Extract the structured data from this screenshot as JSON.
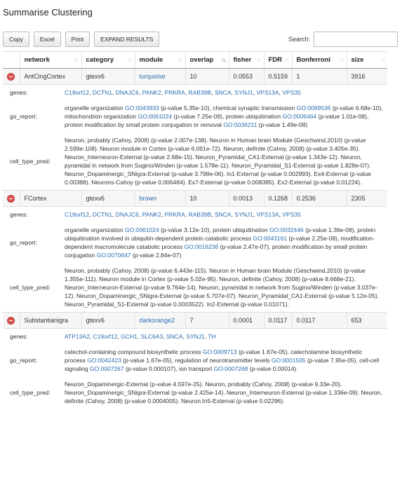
{
  "page": {
    "title": "Summarise Clustering"
  },
  "toolbar": {
    "copy": "Copy",
    "excel": "Excel",
    "print": "Print",
    "expand": "EXPAND RESULTS",
    "search_label": "Search:",
    "search_value": ""
  },
  "columns": [
    "network",
    "category",
    "module",
    "overlap",
    "fisher",
    "FDR",
    "Bonferroni",
    "size"
  ],
  "detail_labels": {
    "genes": "genes:",
    "go_report": "go_report:",
    "cell_type_pred": "cell_type_pred:"
  },
  "rows": [
    {
      "network": "AntCingCortex",
      "category": "gtexv6",
      "module": "turquoise",
      "overlap": "10",
      "fisher": "0.0553",
      "FDR": "0.5159",
      "Bonferroni": "1",
      "size": "3916",
      "genes": [
        "C19orf12",
        "DCTN1",
        "DNAJC6",
        "PANK2",
        "PRKRA",
        "RAB39B",
        "SNCA",
        "SYNJ1",
        "VPS13A",
        "VPS35"
      ],
      "go_report": [
        {
          "text": "organelle organization ",
          "go": "GO:0043933",
          "p": " (p-value 5.35e-10), "
        },
        {
          "text": "chemical synaptic transmission ",
          "go": "GO:0099536",
          "p": " (p-value 6.68e-10), "
        },
        {
          "text": "mitochondrion organization ",
          "go": "GO:0061024",
          "p": " (p-value 7.25e-09), "
        },
        {
          "text": "protein ubiquitination ",
          "go": "GO:0006464",
          "p": " (p-value 1.01e-08), "
        },
        {
          "text": "protein modification by small protein conjugation or removal ",
          "go": "GO:0036211",
          "p": " (p-value 1.49e-08)"
        }
      ],
      "cell_type_pred": "Neuron, probably (Cahoy, 2008) (p-value 2.007e-138). Neuron in Human brain Module (Geschwind,2010) (p-value 2.599e-108). Neuron module in Cortex (p-value 6.091e-72). Neuron, definite (Cahoy, 2008) (p-value 3.405e-35). Neuron_Interneuron-External (p-value 2.68e-15). Neuron_Pyramidal_CA1-External (p-value 1.343e-12). Neuron, pyramidal in network from Sugino/Winden (p-value 1.578e-11). Neuron_Pyramidal_S1-External (p-value 1.828e-07). Neuron_Dopaminergic_SNigra-External (p-value 3.798e-06). In1-External (p-value 0.002993). Ex4-External (p-value 0.00388). Neurons-Cahoy (p-value 0.006484). Ex7-External (p-value 0.008385). Ex2-External (p-value 0.01224)."
    },
    {
      "network": "FCortex",
      "category": "gtexv6",
      "module": "brown",
      "overlap": "10",
      "fisher": "0.0013",
      "FDR": "0.1268",
      "Bonferroni": "0.2536",
      "size": "2305",
      "genes": [
        "C19orf12",
        "DCTN1",
        "DNAJC6",
        "PANK2",
        "PRKRA",
        "RAB39B",
        "SNCA",
        "SYNJ1",
        "VPS13A",
        "VPS35"
      ],
      "go_report": [
        {
          "text": "organelle organization ",
          "go": "GO:0061024",
          "p": " (p-value 3.12e-10), "
        },
        {
          "text": "protein ubiquitination ",
          "go": "GO:0032446",
          "p": " (p-value 1.36e-08), "
        },
        {
          "text": "protein ubiquitination involved in ubiquitin-dependent protein catabolic process ",
          "go": "GO:0043161",
          "p": " (p-value 2.25e-08), "
        },
        {
          "text": "modification-dependent macromolecule catabolic process ",
          "go": "GO:0016236",
          "p": " (p-value 2.47e-07), "
        },
        {
          "text": "protein modification by small protein conjugation ",
          "go": "GO:0070647",
          "p": " (p-value 2.84e-07)"
        }
      ],
      "cell_type_pred": "Neuron, probably (Cahoy, 2008) (p-value 6.443e-115). Neuron in Human brain Module (Geschwind,2010) (p-value 1.355e-111). Neuron module in Cortex (p-value 5.02e-95). Neuron, definite (Cahoy, 2008) (p-value 8.668e-21). Neuron_Interneuron-External (p-value 9.764e-14). Neuron, pyramidal in network from Sugino/Winden (p-value 3.037e-12). Neuron_Dopaminergic_SNigra-External (p-value 5.707e-07). Neuron_Pyramidal_CA1-External (p-value 5.12e-05). Neuron_Pyramidal_S1-External (p-value 0.0003522). In2-External (p-value 0.01071)."
    },
    {
      "network": "Substantianigra",
      "category": "gtexv6",
      "module": "darkorange2",
      "overlap": "7",
      "fisher": "0.0001",
      "FDR": "0.0117",
      "Bonferroni": "0.0117",
      "size": "653",
      "genes": [
        "ATP13A2",
        "C19orf12",
        "GCH1",
        "SLC6A3",
        "SNCA",
        "SYNJ1",
        "TH"
      ],
      "go_report": [
        {
          "text": "catechol-containing compound biosynthetic process ",
          "go": "GO:0009713",
          "p": " (p-value 1.67e-05), "
        },
        {
          "text": "catecholamine biosynthetic process ",
          "go": "GO:0042423",
          "p": " (p-value 1.67e-05), "
        },
        {
          "text": "regulation of neurotransmitter levels ",
          "go": "GO:0001505",
          "p": " (p-value 7.95e-05), "
        },
        {
          "text": "cell-cell signaling ",
          "go": "GO:0007267",
          "p": " (p-value 0.000107), "
        },
        {
          "text": "ion transport ",
          "go": "GO:0007268",
          "p": " (p-value 0.00014)"
        }
      ],
      "cell_type_pred": "Neuron_Dopaminergic-External (p-value 4.597e-25). Neuron, probably (Cahoy, 2008) (p-value 9.33e-20). Neuron_Dopaminergic_SNigra-External (p-value 2.425e-14). Neuron_Interneuron-External (p-value 1.336e-09). Neuron, definite (Cahoy, 2008) (p-value 0.0004005). Neuron.In5-External (p-value 0.02296)."
    }
  ]
}
